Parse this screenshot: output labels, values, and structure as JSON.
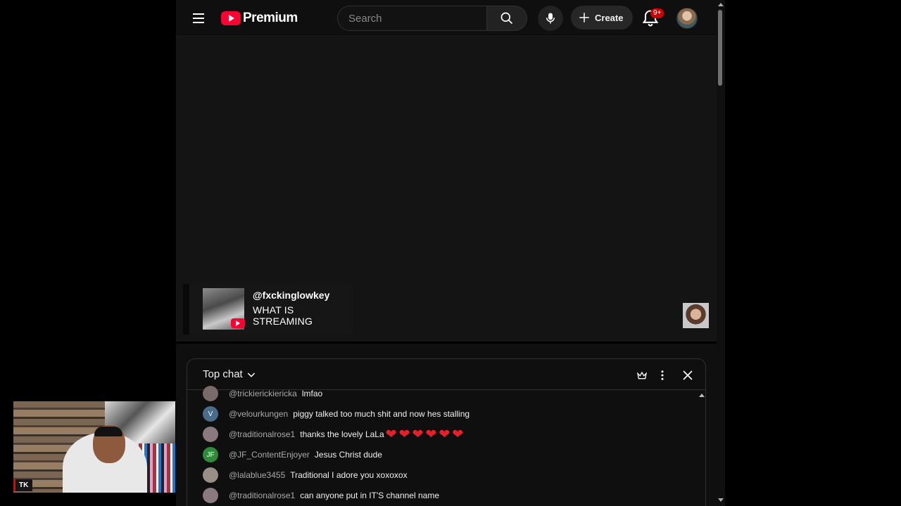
{
  "header": {
    "logo_text": "Premium",
    "search_placeholder": "Search",
    "create_label": "Create",
    "notification_badge": "9+"
  },
  "overlay": {
    "username": "@fxckinglowkey",
    "message": "WHAT IS STREAMING"
  },
  "chat": {
    "mode_label": "Top chat",
    "messages": [
      {
        "initials": "",
        "avatar_color": "#7a6a6a",
        "author": "@trickierickiericka",
        "text": "lmfao"
      },
      {
        "initials": "V",
        "avatar_color": "#4a6c8a",
        "author": "@velourkungen",
        "text": "piggy talked too much shit and now hes stalling"
      },
      {
        "initials": "",
        "avatar_color": "#8a7a80",
        "author": "@traditionalrose1",
        "text": "thanks the lovely LaLa",
        "hearts": "❤❤❤❤❤❤"
      },
      {
        "initials": "JF",
        "avatar_color": "#2e8b3a",
        "author": "@JF_ContentEnjoyer",
        "text": "Jesus Christ dude"
      },
      {
        "initials": "",
        "avatar_color": "#9a8f86",
        "author": "@lalablue3455",
        "text": "Traditional I adore you xoxoxox"
      },
      {
        "initials": "",
        "avatar_color": "#8a7a80",
        "author": "@traditionalrose1",
        "text": "can anyone put in IT'S channel name"
      }
    ]
  },
  "webcam": {
    "label": "TK"
  },
  "colors": {
    "brand_red": "#ff0033",
    "background": "#0f0f0f",
    "badge_red": "#cc0000",
    "heart_red": "#e6202b"
  },
  "icons": [
    "menu-icon",
    "search-icon",
    "mic-icon",
    "plus-icon",
    "bell-icon",
    "crown-icon",
    "more-vert-icon",
    "close-icon",
    "chevron-down-icon"
  ]
}
